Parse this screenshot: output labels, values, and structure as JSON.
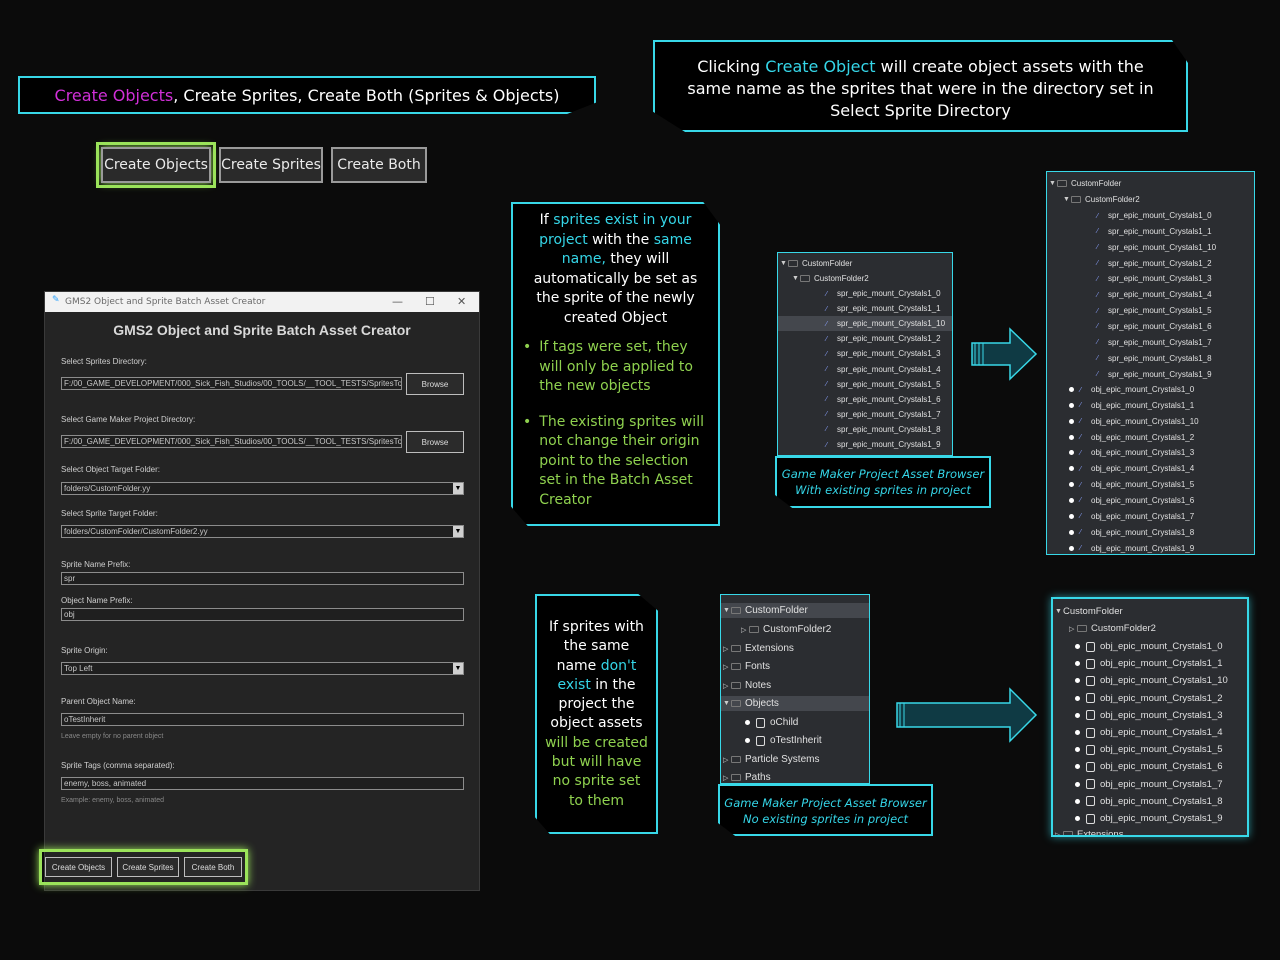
{
  "top_banner": {
    "part1": "Create Objects",
    "part2": ", Create Sprites, Create Both (Sprites & Objects)"
  },
  "top_buttons": [
    "Create Objects",
    "Create Sprites",
    "Create Both"
  ],
  "callout_create_object": {
    "pre": "Clicking ",
    "highlight": "Create Object",
    "post": " will create object assets with the same name as the sprites that were in the directory set in Select Sprite Directory"
  },
  "callout_existing": {
    "l1a": "If ",
    "l1b": "sprites exist in your project",
    "l1c": " with the ",
    "l1d": "same name,",
    "l1e": " they will automatically be set as the sprite of the newly created Object",
    "bullet1": "If tags were set, they will only be applied to the new objects",
    "bullet2": "The existing sprites will not change their origin point to the selection set in the Batch Asset Creator"
  },
  "callout_missing": {
    "a": "If sprites with the same name ",
    "b": "don't exist",
    "c": " in the project the object assets ",
    "d": "will be created but will have no sprite set to them"
  },
  "app": {
    "window_title": "GMS2 Object and Sprite Batch Asset Creator",
    "heading": "GMS2 Object and Sprite Batch Asset Creator",
    "sprites_dir_label": "Select Sprites Directory:",
    "sprites_dir_value": "F:/00_GAME_DEVELOPMENT/000_Sick_Fish_Studios/00_TOOLS/__TOOL_TESTS/SpritesTo",
    "project_dir_label": "Select Game Maker Project Directory:",
    "project_dir_value": "F:/00_GAME_DEVELOPMENT/000_Sick_Fish_Studios/00_TOOLS/__TOOL_TESTS/SpritesTo",
    "browse": "Browse",
    "obj_folder_label": "Select Object Target Folder:",
    "obj_folder_value": "folders/CustomFolder.yy",
    "spr_folder_label": "Select Sprite Target Folder:",
    "spr_folder_value": "folders/CustomFolder/CustomFolder2.yy",
    "spr_prefix_label": "Sprite Name Prefix:",
    "spr_prefix_value": "spr",
    "obj_prefix_label": "Object Name Prefix:",
    "obj_prefix_value": "obj",
    "origin_label": "Sprite Origin:",
    "origin_value": "Top Left",
    "parent_label": "Parent Object Name:",
    "parent_value": "oTestInherit",
    "parent_hint": "Leave empty for no parent object",
    "tags_label": "Sprite Tags (comma separated):",
    "tags_value": "enemy, boss, animated",
    "tags_hint": "Example: enemy, boss, animated",
    "btn_create_objects": "Create Objects",
    "btn_create_sprites": "Create Sprites",
    "btn_create_both": "Create Both"
  },
  "tree_small": {
    "folder": "CustomFolder",
    "subfolder": "CustomFolder2",
    "sprites": [
      "spr_epic_mount_Crystals1_0",
      "spr_epic_mount_Crystals1_1",
      "spr_epic_mount_Crystals1_10",
      "spr_epic_mount_Crystals1_2",
      "spr_epic_mount_Crystals1_3",
      "spr_epic_mount_Crystals1_4",
      "spr_epic_mount_Crystals1_5",
      "spr_epic_mount_Crystals1_6",
      "spr_epic_mount_Crystals1_7",
      "spr_epic_mount_Crystals1_8",
      "spr_epic_mount_Crystals1_9"
    ],
    "caption1": "Game Maker Project Asset Browser",
    "caption2": "With existing sprites in project"
  },
  "tree_right_top": {
    "folder": "CustomFolder",
    "subfolder": "CustomFolder2",
    "sprites": [
      "spr_epic_mount_Crystals1_0",
      "spr_epic_mount_Crystals1_1",
      "spr_epic_mount_Crystals1_10",
      "spr_epic_mount_Crystals1_2",
      "spr_epic_mount_Crystals1_3",
      "spr_epic_mount_Crystals1_4",
      "spr_epic_mount_Crystals1_5",
      "spr_epic_mount_Crystals1_6",
      "spr_epic_mount_Crystals1_7",
      "spr_epic_mount_Crystals1_8",
      "spr_epic_mount_Crystals1_9"
    ],
    "objects": [
      "obj_epic_mount_Crystals1_0",
      "obj_epic_mount_Crystals1_1",
      "obj_epic_mount_Crystals1_10",
      "obj_epic_mount_Crystals1_2",
      "obj_epic_mount_Crystals1_3",
      "obj_epic_mount_Crystals1_4",
      "obj_epic_mount_Crystals1_5",
      "obj_epic_mount_Crystals1_6",
      "obj_epic_mount_Crystals1_7",
      "obj_epic_mount_Crystals1_8",
      "obj_epic_mount_Crystals1_9"
    ]
  },
  "tree_mid_bottom": {
    "items": [
      "CustomFolder",
      "CustomFolder2",
      "Extensions",
      "Fonts",
      "Notes",
      "Objects",
      "oChild",
      "oTestInherit",
      "Particle Systems",
      "Paths"
    ],
    "caption1": "Game Maker Project Asset Browser",
    "caption2": "No existing sprites in project"
  },
  "tree_right_bottom": {
    "folder": "CustomFolder",
    "subfolder": "CustomFolder2",
    "objects": [
      "obj_epic_mount_Crystals1_0",
      "obj_epic_mount_Crystals1_1",
      "obj_epic_mount_Crystals1_10",
      "obj_epic_mount_Crystals1_2",
      "obj_epic_mount_Crystals1_3",
      "obj_epic_mount_Crystals1_4",
      "obj_epic_mount_Crystals1_5",
      "obj_epic_mount_Crystals1_6",
      "obj_epic_mount_Crystals1_7",
      "obj_epic_mount_Crystals1_8",
      "obj_epic_mount_Crystals1_9"
    ],
    "cut_off": "Extensions"
  },
  "colors": {
    "cyan": "#35d6e8",
    "magenta": "#d12fd8",
    "green": "#8fd14f"
  }
}
